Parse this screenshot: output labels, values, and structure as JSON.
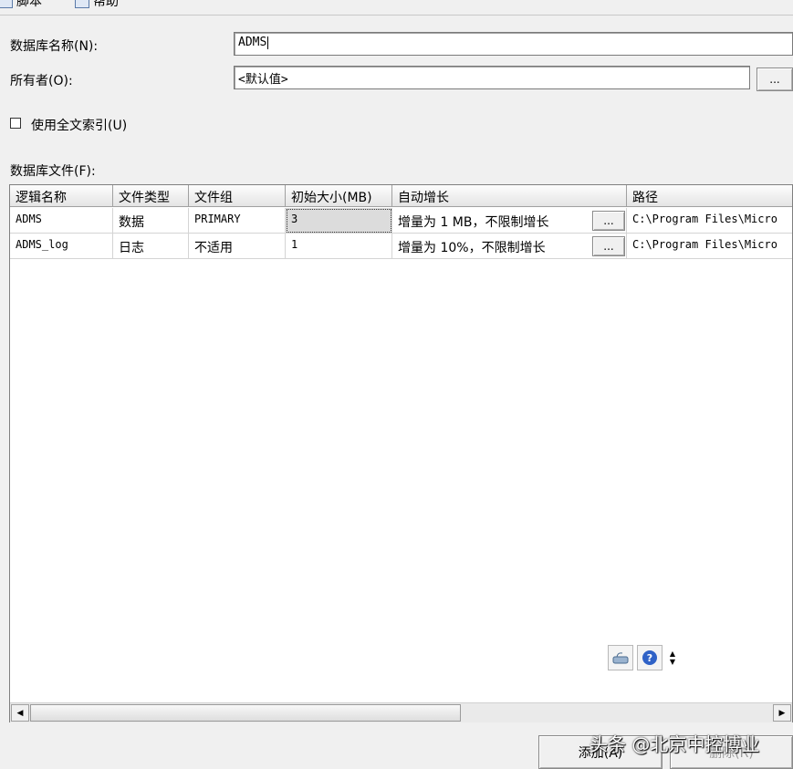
{
  "toolbar": {
    "items": [
      {
        "label": "脚本",
        "icon": "script-icon"
      },
      {
        "label": "帮助",
        "icon": "help-book-icon"
      }
    ]
  },
  "form": {
    "db_name_label": "数据库名称(N):",
    "db_name_value": "ADMS",
    "owner_label": "所有者(O):",
    "owner_value": "<默认值>",
    "owner_browse": "...",
    "fulltext_label": "使用全文索引(U)",
    "fulltext_checked": false,
    "files_label": "数据库文件(F):"
  },
  "grid": {
    "headers": [
      "逻辑名称",
      "文件类型",
      "文件组",
      "初始大小(MB)",
      "自动增长",
      "路径"
    ],
    "rows": [
      {
        "name": "ADMS",
        "type": "数据",
        "group": "PRIMARY",
        "size": "3",
        "growth": "增量为 1 MB，不限制增长",
        "growth_btn": "...",
        "path": "C:\\Program Files\\Micro"
      },
      {
        "name": "ADMS_log",
        "type": "日志",
        "group": "不适用",
        "size": "1",
        "growth": "增量为 10%，不限制增长",
        "growth_btn": "...",
        "path": "C:\\Program Files\\Micro"
      }
    ]
  },
  "buttons": {
    "add": "添加(A)",
    "remove": "删除(R)"
  },
  "watermark": "头条 @北京中控博业"
}
